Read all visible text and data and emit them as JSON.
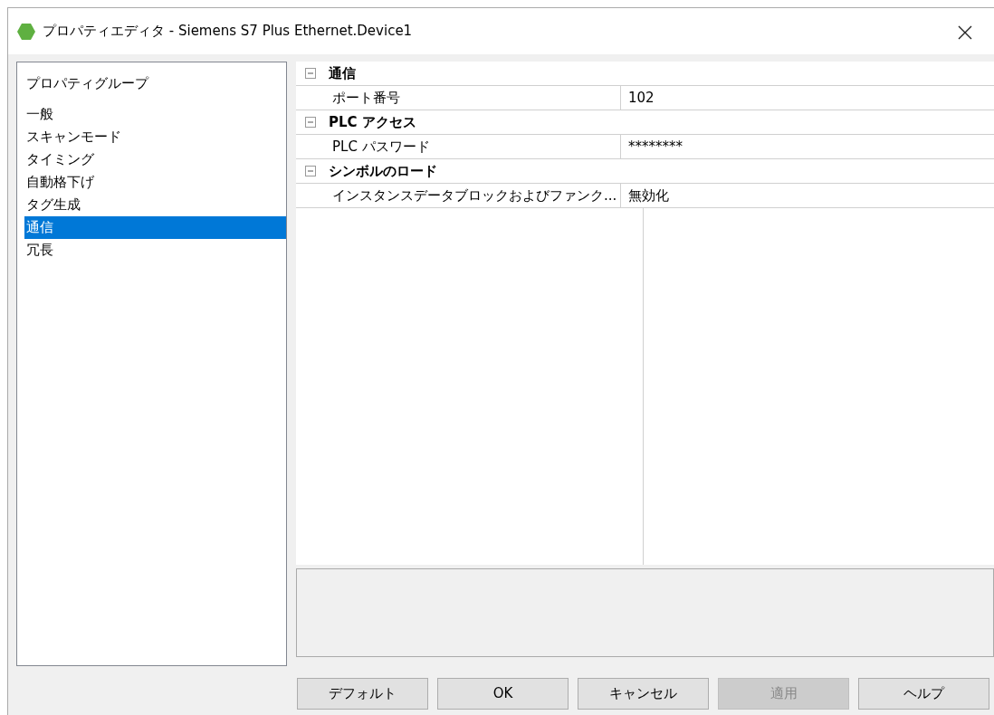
{
  "window": {
    "title": "プロパティエディタ - Siemens S7 Plus Ethernet.Device1"
  },
  "groups": {
    "header": "プロパティグループ",
    "items": [
      {
        "label": "一般",
        "selected": false
      },
      {
        "label": "スキャンモード",
        "selected": false
      },
      {
        "label": "タイミング",
        "selected": false
      },
      {
        "label": "自動格下げ",
        "selected": false
      },
      {
        "label": "タグ生成",
        "selected": false
      },
      {
        "label": "通信",
        "selected": true
      },
      {
        "label": "冗長",
        "selected": false
      }
    ]
  },
  "properties": [
    {
      "category": "通信",
      "expanded": true,
      "rows": [
        {
          "name": "ポート番号",
          "value": "102"
        }
      ]
    },
    {
      "category": "PLC アクセス",
      "expanded": true,
      "rows": [
        {
          "name": "PLC パスワード",
          "value": "********"
        }
      ]
    },
    {
      "category": "シンボルのロード",
      "expanded": true,
      "rows": [
        {
          "name": "インスタンスデータブロックおよびファンク...",
          "value": "無効化"
        }
      ]
    }
  ],
  "buttons": [
    {
      "label": "デフォルト",
      "disabled": false
    },
    {
      "label": "OK",
      "disabled": false
    },
    {
      "label": "キャンセル",
      "disabled": false
    },
    {
      "label": "適用",
      "disabled": true
    },
    {
      "label": "ヘルプ",
      "disabled": false
    }
  ]
}
